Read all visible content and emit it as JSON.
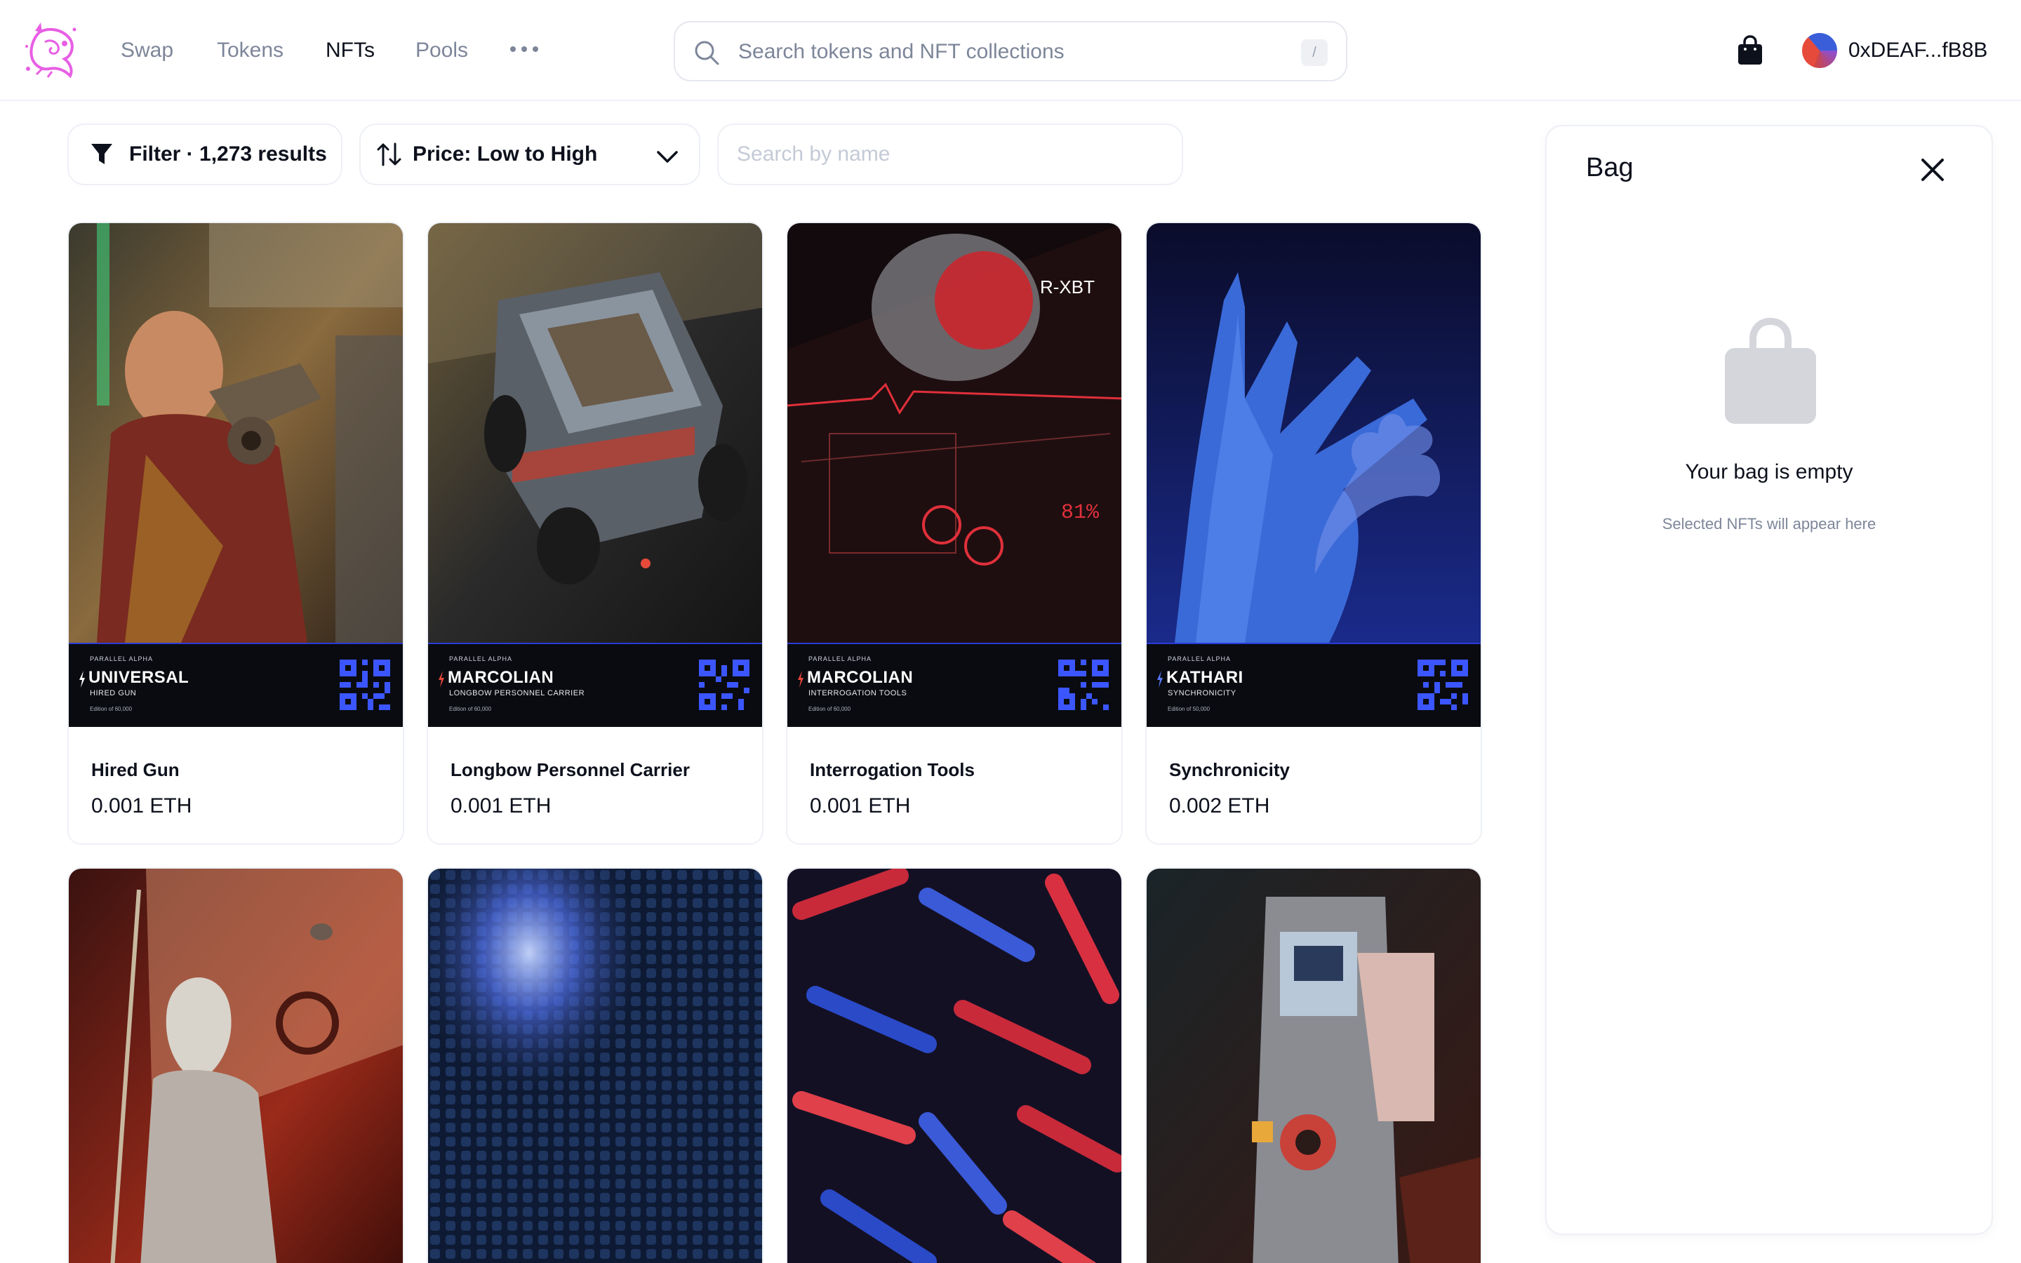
{
  "nav": {
    "links": [
      {
        "label": "Swap"
      },
      {
        "label": "Tokens"
      },
      {
        "label": "NFTs"
      },
      {
        "label": "Pools"
      }
    ],
    "active": "NFTs",
    "more_icon": "more-dots-icon",
    "search_placeholder": "Search tokens and NFT collections",
    "search_shortcut": "/",
    "account_label": "0xDEAF...fB8B"
  },
  "toolbar": {
    "filter_label": "Filter · 1,273 results",
    "sort_label": "Price: Low to High",
    "name_search_placeholder": "Search by name"
  },
  "cards": [
    {
      "name": "Hired Gun",
      "price": "0.001 ETH",
      "banner": {
        "set": "PARALLEL ALPHA",
        "faction": "UNIVERSAL",
        "subtitle": "HIRED GUN",
        "edition": "Edition of 60,000"
      }
    },
    {
      "name": "Longbow Personnel Carrier",
      "price": "0.001 ETH",
      "banner": {
        "set": "PARALLEL ALPHA",
        "faction": "MARCOLIAN",
        "subtitle": "LONGBOW PERSONNEL CARRIER",
        "edition": "Edition of 60,000"
      }
    },
    {
      "name": "Interrogation Tools",
      "price": "0.001 ETH",
      "banner": {
        "set": "PARALLEL ALPHA",
        "faction": "MARCOLIAN",
        "subtitle": "INTERROGATION TOOLS",
        "edition": "Edition of 60,000"
      }
    },
    {
      "name": "Synchronicity",
      "price": "0.002 ETH",
      "banner": {
        "set": "PARALLEL ALPHA",
        "faction": "KATHARI",
        "subtitle": "SYNCHRONICITY",
        "edition": "Edition of 50,000"
      }
    },
    {
      "name": "",
      "price": ""
    },
    {
      "name": "",
      "price": ""
    },
    {
      "name": "",
      "price": ""
    },
    {
      "name": "",
      "price": ""
    }
  ],
  "bag": {
    "title": "Bag",
    "empty_title": "Your bag is empty",
    "empty_subtitle": "Selected NFTs will appear here"
  },
  "colors": {
    "text_primary": "#0d111c",
    "text_secondary": "#7d8699",
    "border": "#edf0f5",
    "logo_pink": "#e85ee4"
  }
}
